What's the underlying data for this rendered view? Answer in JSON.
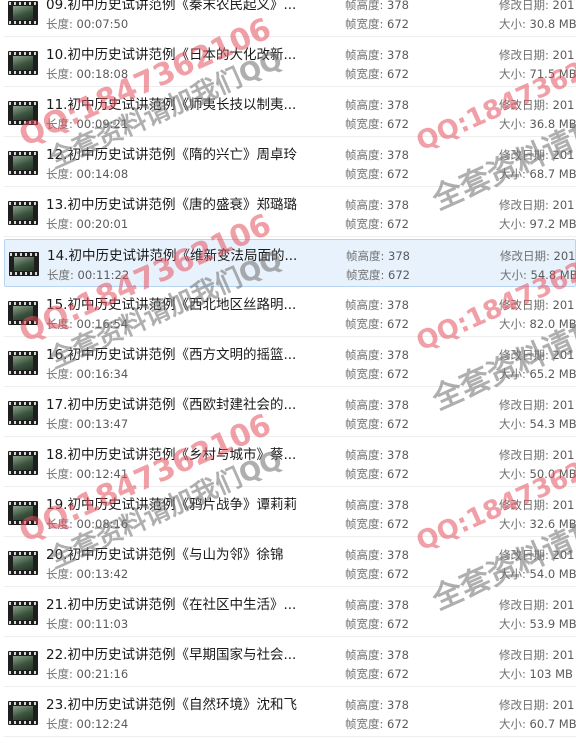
{
  "labels": {
    "length": "长度:",
    "frame_height": "帧高度:",
    "frame_width": "帧宽度:",
    "modified": "修改日期:",
    "size": "大小:"
  },
  "items": [
    {
      "title": "09.初中历史试讲范例《秦末农民起义》...",
      "length": "00:07:50",
      "frame_height": "378",
      "frame_width": "672",
      "modified": "201",
      "size": "30.8 MB"
    },
    {
      "title": "10.初中历史试讲范例《日本的大化改新...",
      "length": "00:18:08",
      "frame_height": "378",
      "frame_width": "672",
      "modified": "201",
      "size": "71.5 MB"
    },
    {
      "title": "11.初中历史试讲范例《师夷长技以制夷...",
      "length": "00:09:21",
      "frame_height": "378",
      "frame_width": "672",
      "modified": "201",
      "size": "36.8 MB"
    },
    {
      "title": "12.初中历史试讲范例《隋的兴亡》周卓玲",
      "length": "00:14:08",
      "frame_height": "378",
      "frame_width": "672",
      "modified": "201",
      "size": "68.7 MB"
    },
    {
      "title": "13.初中历史试讲范例《唐的盛衰》郑璐璐",
      "length": "00:20:01",
      "frame_height": "378",
      "frame_width": "672",
      "modified": "201",
      "size": "97.2 MB"
    },
    {
      "title": "14.初中历史试讲范例《维新变法局面的...",
      "length": "00:11:22",
      "frame_height": "378",
      "frame_width": "672",
      "modified": "201",
      "size": "54.8 MB",
      "selected": true
    },
    {
      "title": "15.初中历史试讲范例《西北地区丝路明...",
      "length": "00:16:54",
      "frame_height": "378",
      "frame_width": "672",
      "modified": "201",
      "size": "82.0 MB"
    },
    {
      "title": "16.初中历史试讲范例《西方文明的摇篮...",
      "length": "00:16:34",
      "frame_height": "378",
      "frame_width": "672",
      "modified": "201",
      "size": "65.2 MB"
    },
    {
      "title": "17.初中历史试讲范例《西欧封建社会的...",
      "length": "00:13:47",
      "frame_height": "378",
      "frame_width": "672",
      "modified": "201",
      "size": "54.3 MB"
    },
    {
      "title": "18.初中历史试讲范例《乡村与城市》蔡...",
      "length": "00:12:41",
      "frame_height": "378",
      "frame_width": "672",
      "modified": "201",
      "size": "50.0 MB"
    },
    {
      "title": "19.初中历史试讲范例《鸦片战争》谭莉莉",
      "length": "00:08:16",
      "frame_height": "378",
      "frame_width": "672",
      "modified": "201",
      "size": "32.6 MB"
    },
    {
      "title": "20.初中历史试讲范例《与山为邻》徐锦",
      "length": "00:13:42",
      "frame_height": "378",
      "frame_width": "672",
      "modified": "201",
      "size": "54.0 MB"
    },
    {
      "title": "21.初中历史试讲范例《在社区中生活》...",
      "length": "00:11:03",
      "frame_height": "378",
      "frame_width": "672",
      "modified": "201",
      "size": "53.9 MB"
    },
    {
      "title": "22.初中历史试讲范例《早期国家与社会...",
      "length": "00:21:16",
      "frame_height": "378",
      "frame_width": "672",
      "modified": "201",
      "size": "103 MB"
    },
    {
      "title": "23.初中历史试讲范例《自然环境》沈和飞",
      "length": "00:12:24",
      "frame_height": "378",
      "frame_width": "672",
      "modified": "201",
      "size": "60.7 MB"
    }
  ],
  "watermarks": {
    "qq": "QQ:1847362106",
    "text1": "全套资料请加我们QQ",
    "text2": "全套资料请加"
  },
  "colors": {
    "selected_bg": "#e8f2fc",
    "selected_border": "#b7d5f2",
    "watermark": "#e6505f"
  }
}
